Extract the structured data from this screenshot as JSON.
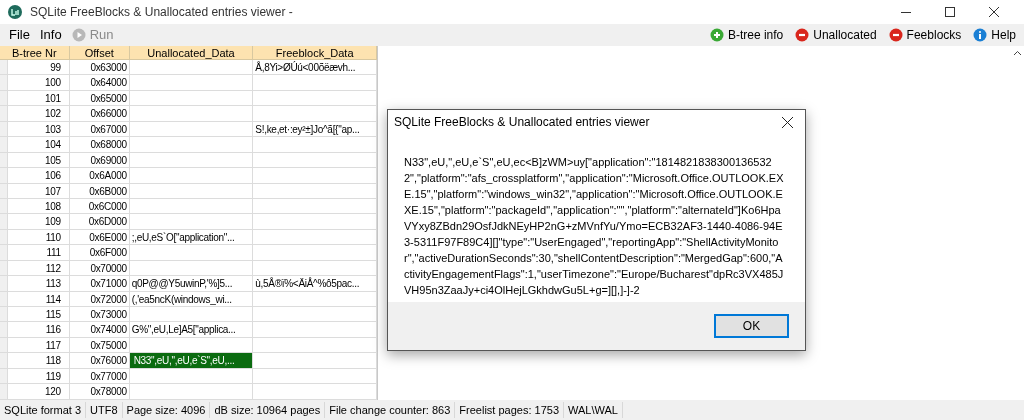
{
  "window": {
    "title": "SQLite FreeBlocks & Unallocated entries viewer -"
  },
  "menu": [
    {
      "label": "File",
      "kind": "menu",
      "disabled": false
    },
    {
      "label": "Info",
      "kind": "menu",
      "disabled": false
    },
    {
      "label": "Run",
      "kind": "run",
      "disabled": true
    }
  ],
  "toolbar": [
    {
      "label": "B-tree info",
      "kind": "add"
    },
    {
      "label": "Unallocated",
      "kind": "remove"
    },
    {
      "label": "Feeblocks",
      "kind": "remove"
    },
    {
      "label": "Help",
      "kind": "info"
    }
  ],
  "table": {
    "columns": [
      "B-tree Nr",
      "Offset",
      "Unallocated_Data",
      "Freeblock_Data"
    ],
    "rows": [
      {
        "cells": [
          "99",
          "0x63000",
          "",
          "Å,8Yi>ØÚú<00õëævh..."
        ],
        "selected": false
      },
      {
        "cells": [
          "100",
          "0x64000",
          "",
          ""
        ],
        "selected": false
      },
      {
        "cells": [
          "101",
          "0x65000",
          "",
          ""
        ],
        "selected": false
      },
      {
        "cells": [
          "102",
          "0x66000",
          "",
          ""
        ],
        "selected": false
      },
      {
        "cells": [
          "103",
          "0x67000",
          "",
          "S!,ke,et·:ey²±]Jo^ã[{\"ap..."
        ],
        "selected": false
      },
      {
        "cells": [
          "104",
          "0x68000",
          "",
          ""
        ],
        "selected": false
      },
      {
        "cells": [
          "105",
          "0x69000",
          "",
          ""
        ],
        "selected": false
      },
      {
        "cells": [
          "106",
          "0x6A000",
          "",
          ""
        ],
        "selected": false
      },
      {
        "cells": [
          "107",
          "0x6B000",
          "",
          ""
        ],
        "selected": false
      },
      {
        "cells": [
          "108",
          "0x6C000",
          "",
          ""
        ],
        "selected": false
      },
      {
        "cells": [
          "109",
          "0x6D000",
          "",
          ""
        ],
        "selected": false
      },
      {
        "cells": [
          "110",
          "0x6E000",
          ";,eU,eS`O[\"application\"...",
          ""
        ],
        "selected": false
      },
      {
        "cells": [
          "111",
          "0x6F000",
          "",
          ""
        ],
        "selected": false
      },
      {
        "cells": [
          "112",
          "0x70000",
          "",
          ""
        ],
        "selected": false
      },
      {
        "cells": [
          "113",
          "0x71000",
          "q0P@@Y5uwinP,'%]5...",
          "ù,5Å®ï%<ÄiÅ^%ô5pac..."
        ],
        "selected": false
      },
      {
        "cells": [
          "114",
          "0x72000",
          "(,'ea5ncK(windows_wi...",
          ""
        ],
        "selected": false
      },
      {
        "cells": [
          "115",
          "0x73000",
          "",
          ""
        ],
        "selected": false
      },
      {
        "cells": [
          "116",
          "0x74000",
          "G%\",eU,Le]A5[\"applica...",
          ""
        ],
        "selected": false
      },
      {
        "cells": [
          "117",
          "0x75000",
          "",
          ""
        ],
        "selected": false
      },
      {
        "cells": [
          "118",
          "0x76000",
          "N33\",eU,\",eU,e`S\",eU,...",
          ""
        ],
        "selected": true
      },
      {
        "cells": [
          "119",
          "0x77000",
          "",
          ""
        ],
        "selected": false
      },
      {
        "cells": [
          "120",
          "0x78000",
          "",
          ""
        ],
        "selected": false
      }
    ]
  },
  "dialog": {
    "title": "SQLite FreeBlocks & Unallocated entries viewer",
    "message": "N33\",eU,\",eU,e`S\",eU,ec<B]zWM>uy[\"application\":\"18148218383001365322\",\"platform\":\"afs_crossplatform\",\"application\":\"Microsoft.Office.OUTLOOK.EXE.15\",\"platform\":\"windows_win32\",\"application\":\"Microsoft.Office.OUTLOOK.EXE.15\",\"platform\":\"packageId\",\"application\":\"\",\"platform\":\"alternateId\"]Ko6HpaVYxy8ZBdn29OsfJdkNEyHP2nG+zMVnfYu/Ymo=ECB32AF3-1440-4086-94E3-5311F97F89C4][]\"type\":\"UserEngaged\",\"reportingApp\":\"ShellActivityMonitor\",\"activeDurationSeconds\":30,\"shellContentDescription\":\"MergedGap\":600,\"ActivityEngagementFlags\":1,\"userTimezone\":\"Europe/Bucharest\"dpRc3VX485JVH95n3ZaaJy+ci4OlHejLGkhdwGu5L+g=][],]-]-2",
    "button": "OK"
  },
  "status_bar": [
    "SQLite format 3",
    "UTF8",
    "Page size: 4096",
    "dB size: 10964 pages",
    "File change counter: 863",
    "Freelist pages: 1753",
    "WAL\\WAL"
  ]
}
